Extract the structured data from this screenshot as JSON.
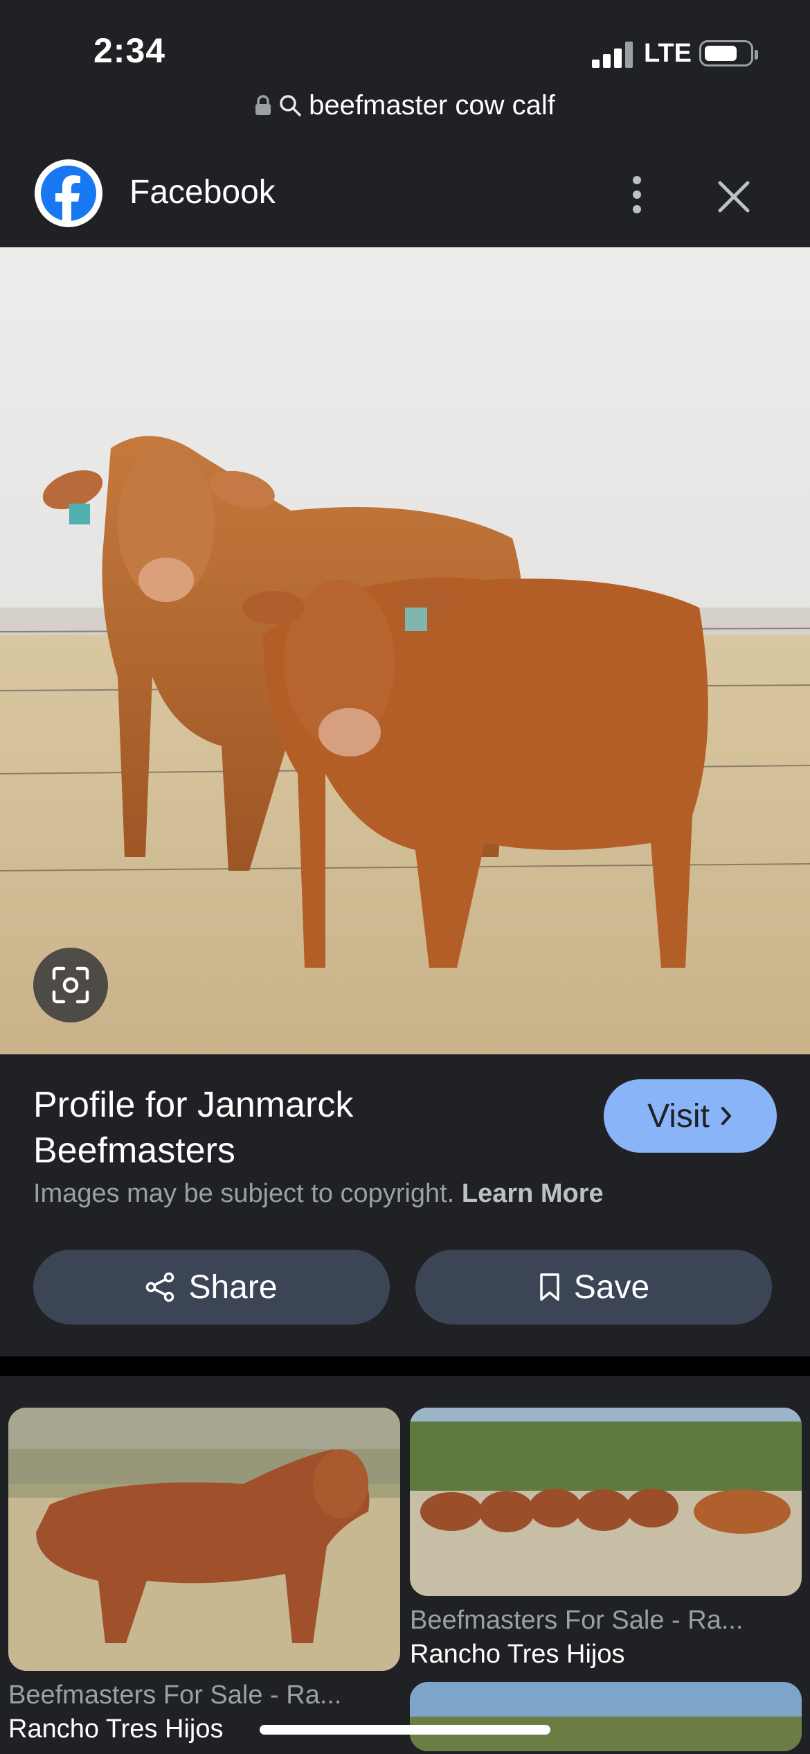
{
  "status_bar": {
    "time": "2:34",
    "network": "LTE"
  },
  "url_bar": {
    "query": "beefmaster cow calf"
  },
  "header": {
    "source": "Facebook"
  },
  "result": {
    "title": "Profile for Janmarck Beefmasters",
    "visit_label": "Visit",
    "copyright_text": "Images may be subject to copyright.",
    "learn_more": "Learn More",
    "share_label": "Share",
    "save_label": "Save"
  },
  "related": [
    {
      "title": "Beefmasters For Sale - Ra...",
      "subtitle": "Rancho Tres Hijos"
    },
    {
      "title": "Beefmasters For Sale - Ra...",
      "subtitle": "Rancho Tres Hijos"
    }
  ],
  "colors": {
    "background": "#202124",
    "accent": "#8ab4f8",
    "button": "#3c4556"
  }
}
